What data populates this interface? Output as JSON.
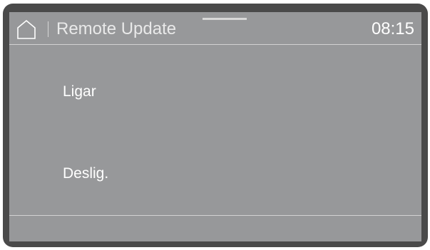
{
  "header": {
    "home_icon": "home-icon",
    "title": "Remote Update",
    "time": "08:15"
  },
  "options": [
    {
      "label": "Ligar"
    },
    {
      "label": "Deslig."
    }
  ]
}
